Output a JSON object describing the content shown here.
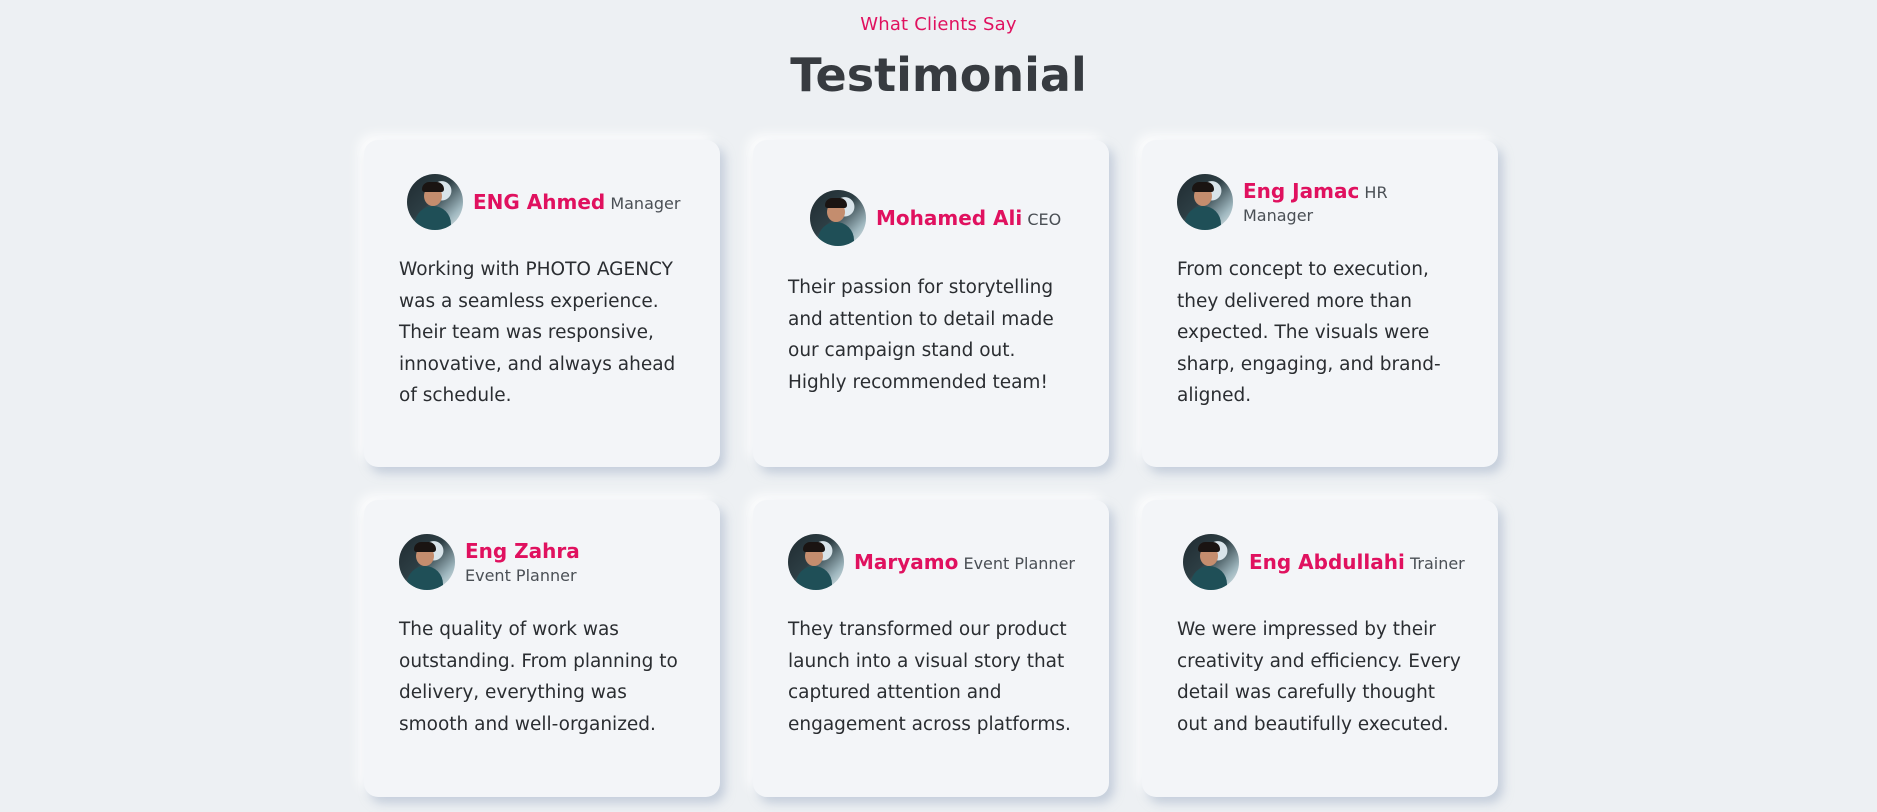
{
  "header": {
    "eyebrow": "What Clients Say",
    "title": "Testimonial"
  },
  "colors": {
    "accent": "#e0115f",
    "background": "#edf0f3",
    "card": "#f3f5f8",
    "title": "#373b40"
  },
  "testimonials": [
    {
      "name": "ENG Ahmed",
      "role": "Manager",
      "quote": "Working with PHOTO AGENCY was a seamless experience. Their team was responsive, innovative, and always ahead of schedule."
    },
    {
      "name": "Mohamed Ali",
      "role": "CEO",
      "quote": "Their passion for storytelling and attention to detail made our campaign stand out. Highly recommended team!"
    },
    {
      "name": "Eng Jamac",
      "role": "HR Manager",
      "quote": "From concept to execution, they delivered more than expected. The visuals were sharp, engaging, and brand-aligned."
    },
    {
      "name": "Eng Zahra",
      "role": "Event Planner",
      "quote": "The quality of work was outstanding. From planning to delivery, everything was smooth and well-organized."
    },
    {
      "name": "Maryamo",
      "role": "Event Planner",
      "quote": "They transformed our product launch into a visual story that captured attention and engagement across platforms."
    },
    {
      "name": "Eng Abdullahi",
      "role": "Trainer",
      "quote": "We were impressed by their creativity and efficiency. Every detail was carefully thought out and beautifully executed."
    }
  ]
}
